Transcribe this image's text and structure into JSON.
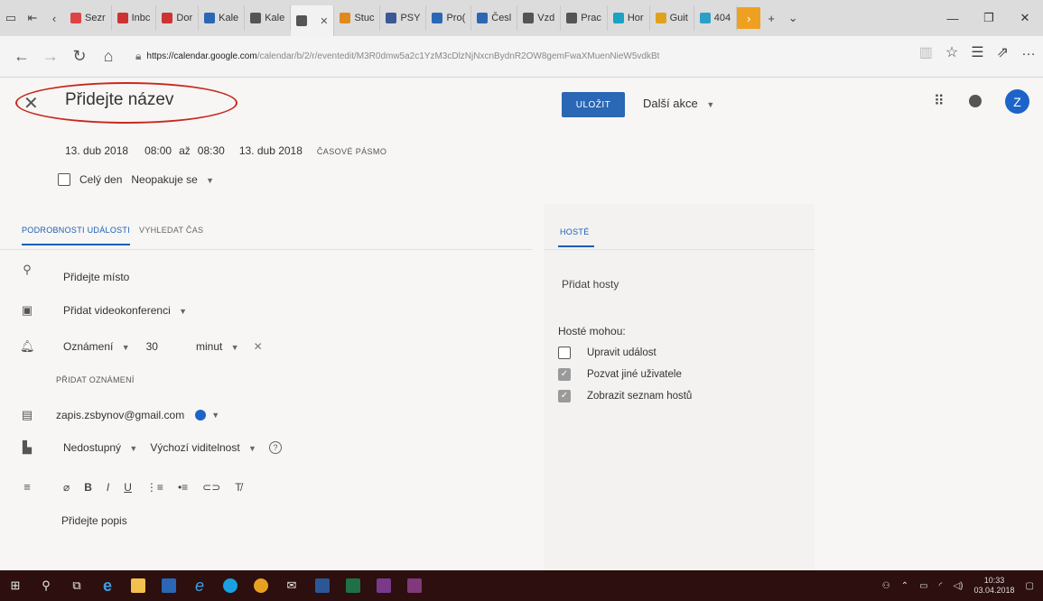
{
  "browser": {
    "tabs": [
      {
        "label": "Sezr",
        "color": "#d44"
      },
      {
        "label": "Inbc",
        "color": "#c33",
        "glyph": "M"
      },
      {
        "label": "Dor",
        "color": "#c33",
        "glyph": "M"
      },
      {
        "label": "Kale",
        "color": "#2a67b5"
      },
      {
        "label": "Kale",
        "color": "#555"
      },
      {
        "label": "",
        "color": "#555",
        "active": true
      },
      {
        "label": "Stuc",
        "color": "#e08a1e"
      },
      {
        "label": "PSY",
        "color": "#3b5998"
      },
      {
        "label": "Pro(",
        "color": "#2a67b5"
      },
      {
        "label": "Česl",
        "color": "#2a67b5"
      },
      {
        "label": "Vzd",
        "color": "#555"
      },
      {
        "label": "Prac",
        "color": "#555"
      },
      {
        "label": "Hor",
        "color": "#1aa3c4"
      },
      {
        "label": "Guit",
        "color": "#e0a21e"
      },
      {
        "label": "404",
        "color": "#2aa0c8"
      }
    ],
    "url_domain": "https://calendar.google.com",
    "url_path": "/calendar/b/2/r/eventedit/M3R0dmw5a2c1YzM3cDlzNjNxcnBydnR2OW8gemFwaXMuenNieW5vdkBt"
  },
  "header": {
    "title_placeholder": "Přidejte název",
    "save_label": "ULOŽIT",
    "more_actions_label": "Další akce",
    "avatar_letter": "Z"
  },
  "datetime": {
    "start_date": "13. dub 2018",
    "start_time": "08:00",
    "to": "až",
    "end_time": "08:30",
    "end_date": "13. dub 2018",
    "timezone_label": "ČASOVÉ PÁSMO",
    "all_day_label": "Celý den",
    "repeat_label": "Neopakuje se"
  },
  "tabs": {
    "details": "PODROBNOSTI UDÁLOSTI",
    "find_time": "VYHLEDAT ČAS"
  },
  "details": {
    "location_placeholder": "Přidejte místo",
    "video_label": "Přidat videokonferenci",
    "notification_type": "Oznámení",
    "notification_value": "30",
    "notification_unit": "minut",
    "add_notification": "PŘIDAT OZNÁMENÍ",
    "calendar_owner": "zapis.zsbynov@gmail.com",
    "calendar_color": "#1e64c8",
    "availability": "Nedostupný",
    "visibility": "Výchozí viditelnost",
    "description_placeholder": "Přidejte popis"
  },
  "guests": {
    "tab_label": "HOSTÉ",
    "add_placeholder": "Přidat hosty",
    "can_label": "Hosté mohou:",
    "permissions": [
      {
        "label": "Upravit událost",
        "checked": false
      },
      {
        "label": "Pozvat jiné uživatele",
        "checked": true
      },
      {
        "label": "Zobrazit seznam hostů",
        "checked": true
      }
    ]
  },
  "taskbar": {
    "time": "10:33",
    "date": "03.04.2018"
  }
}
